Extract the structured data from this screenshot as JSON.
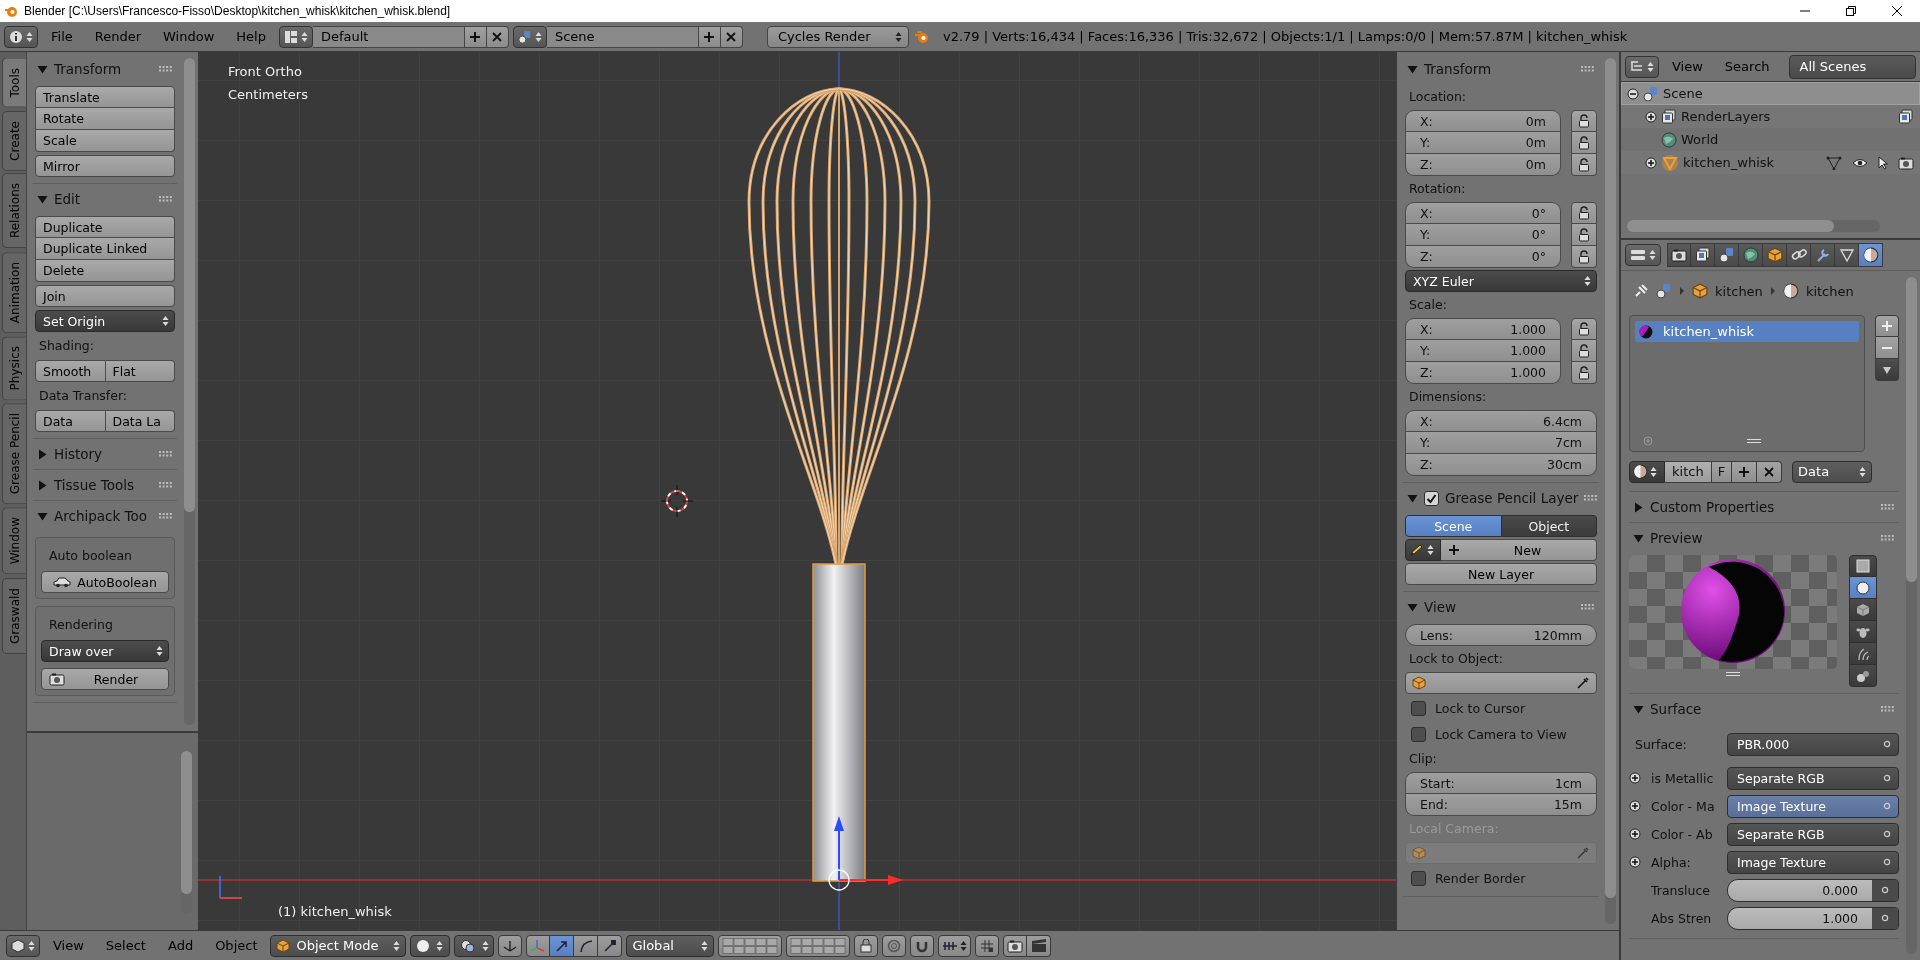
{
  "title_bar": {
    "title": "Blender [C:\\Users\\Francesco-Fisso\\Desktop\\kitchen_whisk\\kitchen_whisk.blend]"
  },
  "info_header": {
    "menus": [
      "File",
      "Render",
      "Window",
      "Help"
    ],
    "screen_layout": "Default",
    "scene": "Scene",
    "render_engine": "Cycles Render",
    "stats": "v2.79 | Verts:16,434 | Faces:16,336 | Tris:32,672 | Objects:1/1 | Lamps:0/0 | Mem:57.87M | kitchen_whisk"
  },
  "tool_shelf": {
    "tabs": [
      {
        "label": "Tools",
        "selected": true
      },
      {
        "label": "Create",
        "selected": false
      },
      {
        "label": "Relations",
        "selected": false
      },
      {
        "label": "Animation",
        "selected": false
      },
      {
        "label": "Physics",
        "selected": false
      },
      {
        "label": "Grease Pencil",
        "selected": false
      },
      {
        "label": "Window",
        "selected": false
      },
      {
        "label": "Graswald",
        "selected": false
      }
    ],
    "panels": [
      {
        "title": "Transform",
        "expanded": true,
        "items": [
          {
            "kind": "stack",
            "labels": [
              "Translate",
              "Rotate",
              "Scale"
            ]
          },
          {
            "kind": "button",
            "label": "Mirror"
          }
        ]
      },
      {
        "title": "Edit",
        "expanded": true,
        "items": [
          {
            "kind": "stack",
            "labels": [
              "Duplicate",
              "Duplicate Linked",
              "Delete"
            ]
          },
          {
            "kind": "button",
            "label": "Join"
          },
          {
            "kind": "dropdown",
            "value": "Set Origin"
          },
          {
            "kind": "label",
            "text": "Shading:",
            "disabled": false
          },
          {
            "kind": "row",
            "labels": [
              "Smooth",
              "Flat"
            ]
          },
          {
            "kind": "label",
            "text": "Data Transfer:",
            "disabled": false
          },
          {
            "kind": "row",
            "labels": [
              "Data",
              "Data La"
            ]
          }
        ]
      },
      {
        "title": "History",
        "expanded": false
      },
      {
        "title": "Tissue Tools",
        "expanded": false
      },
      {
        "title": "Archipack Too",
        "expanded": true,
        "items": [
          {
            "kind": "box",
            "items": [
              {
                "kind": "box_label",
                "text": "Auto boolean"
              },
              {
                "kind": "boolean_button",
                "label": "AutoBoolean"
              }
            ]
          },
          {
            "kind": "box",
            "items": [
              {
                "kind": "box_label",
                "text": "Rendering"
              },
              {
                "kind": "dropdown",
                "value": "Draw over"
              },
              {
                "kind": "render_button",
                "label": "Render"
              }
            ]
          }
        ]
      }
    ]
  },
  "viewport": {
    "view_name": "Front Ortho",
    "units": "Centimeters",
    "object_info": "(1) kitchen_whisk"
  },
  "n_panel": {
    "panels": [
      {
        "title": "Transform",
        "expanded": true,
        "items": [
          {
            "kind": "label",
            "text": "Location:",
            "disabled": false
          },
          {
            "kind": "vector",
            "locks": true,
            "fields": [
              {
                "axis": "X:",
                "value": "0m"
              },
              {
                "axis": "Y:",
                "value": "0m"
              },
              {
                "axis": "Z:",
                "value": "0m"
              }
            ]
          },
          {
            "kind": "label",
            "text": "Rotation:",
            "disabled": false
          },
          {
            "kind": "vector",
            "locks": true,
            "fields": [
              {
                "axis": "X:",
                "value": "0°"
              },
              {
                "axis": "Y:",
                "value": "0°"
              },
              {
                "axis": "Z:",
                "value": "0°"
              }
            ]
          },
          {
            "kind": "dropdown",
            "value": "XYZ Euler"
          },
          {
            "kind": "label",
            "text": "Scale:",
            "disabled": false
          },
          {
            "kind": "vector",
            "locks": true,
            "fields": [
              {
                "axis": "X:",
                "value": "1.000"
              },
              {
                "axis": "Y:",
                "value": "1.000"
              },
              {
                "axis": "Z:",
                "value": "1.000"
              }
            ]
          },
          {
            "kind": "label",
            "text": "Dimensions:",
            "disabled": false
          },
          {
            "kind": "vector",
            "locks": false,
            "fields": [
              {
                "axis": "X:",
                "value": "6.4cm"
              },
              {
                "axis": "Y:",
                "value": "7cm"
              },
              {
                "axis": "Z:",
                "value": "30cm"
              }
            ]
          }
        ]
      },
      {
        "title": "Grease Pencil Layer",
        "expanded": true,
        "checked": true,
        "items": [
          {
            "kind": "toggle",
            "options": [
              {
                "label": "Scene",
                "selected": true
              },
              {
                "label": "Object",
                "selected": false
              }
            ]
          },
          {
            "kind": "new",
            "label": "New"
          },
          {
            "kind": "button",
            "label": "New Layer"
          }
        ]
      },
      {
        "title": "View",
        "expanded": true,
        "items": [
          {
            "kind": "number",
            "label": "Lens:",
            "value": "120mm"
          },
          {
            "kind": "label",
            "text": "Lock to Object:",
            "disabled": false
          },
          {
            "kind": "object_field",
            "disabled": false
          },
          {
            "kind": "checkbox",
            "label": "Lock to Cursor",
            "checked": false
          },
          {
            "kind": "checkbox",
            "label": "Lock Camera to View",
            "checked": false
          },
          {
            "kind": "label",
            "text": "Clip:",
            "disabled": false
          },
          {
            "kind": "vector",
            "locks": false,
            "fields": [
              {
                "axis": "Start:",
                "value": "1cm"
              },
              {
                "axis": "End:",
                "value": "15m"
              }
            ]
          },
          {
            "kind": "label",
            "text": "Local Camera:",
            "disabled": true
          },
          {
            "kind": "object_field",
            "disabled": true
          },
          {
            "kind": "checkbox",
            "label": "Render Border",
            "checked": false
          }
        ]
      }
    ]
  },
  "outliner": {
    "menus": [
      "View",
      "Search"
    ],
    "display": "All Scenes",
    "tree": [
      {
        "name": "Scene",
        "kind": "scene",
        "selected": true,
        "expanded": true,
        "children": [
          {
            "name": "RenderLayers",
            "kind": "render_layers",
            "selected": false,
            "expanded": false
          },
          {
            "name": "World",
            "kind": "world",
            "selected": false
          },
          {
            "name": "kitchen_whisk",
            "kind": "mesh_object",
            "selected": false,
            "expanded": false
          }
        ]
      }
    ]
  },
  "properties": {
    "tabs": [
      {
        "kind": "render",
        "selected": false
      },
      {
        "kind": "render_layers",
        "selected": false
      },
      {
        "kind": "scene",
        "selected": false
      },
      {
        "kind": "world",
        "selected": false
      },
      {
        "kind": "object",
        "selected": false
      },
      {
        "kind": "constraints",
        "selected": false
      },
      {
        "kind": "modifiers",
        "selected": false
      },
      {
        "kind": "data",
        "selected": false
      },
      {
        "kind": "material",
        "selected": true
      }
    ],
    "breadcrumb": [
      "kitchen",
      "kitchen"
    ],
    "material_slots": [
      {
        "name": "kitchen_whisk",
        "selected": true
      }
    ],
    "datablock": {
      "name": "kitch",
      "fake_user": "F",
      "link": "Data"
    },
    "panels": [
      {
        "title": "Custom Properties",
        "expanded": false
      },
      {
        "title": "Preview",
        "expanded": true,
        "preview_modes": [
          {
            "kind": "flat",
            "selected": false
          },
          {
            "kind": "sphere",
            "selected": true
          },
          {
            "kind": "cube",
            "selected": false
          },
          {
            "kind": "monkey",
            "selected": false
          },
          {
            "kind": "hair",
            "selected": false
          },
          {
            "kind": "sky",
            "selected": false
          }
        ]
      },
      {
        "title": "Surface",
        "expanded": true,
        "rows": [
          {
            "kind": "shader",
            "label": "Surface:",
            "value": "PBR.000",
            "active": false
          },
          {
            "kind": "input",
            "label": "is Metallic",
            "value": "Separate RGB",
            "active": false
          },
          {
            "kind": "input",
            "label": "Color - Ma",
            "value": "Image Texture",
            "active": true
          },
          {
            "kind": "input",
            "label": "Color - Ab",
            "value": "Separate RGB",
            "active": false
          },
          {
            "kind": "input",
            "label": "Alpha:",
            "value": "Image Texture",
            "active": false
          },
          {
            "kind": "number",
            "label": "Transluce",
            "value": "0.000",
            "active": false
          },
          {
            "kind": "number",
            "label": "Abs Stren",
            "value": "1.000",
            "active": false
          }
        ]
      }
    ]
  },
  "bottom_header": {
    "menus": [
      "View",
      "Select",
      "Add",
      "Object"
    ],
    "mode": "Object Mode",
    "manipulators": [
      {
        "kind": "translate",
        "selected": true
      },
      {
        "kind": "rotate",
        "selected": false
      },
      {
        "kind": "scale",
        "selected": false
      }
    ],
    "orientation": "Global"
  }
}
